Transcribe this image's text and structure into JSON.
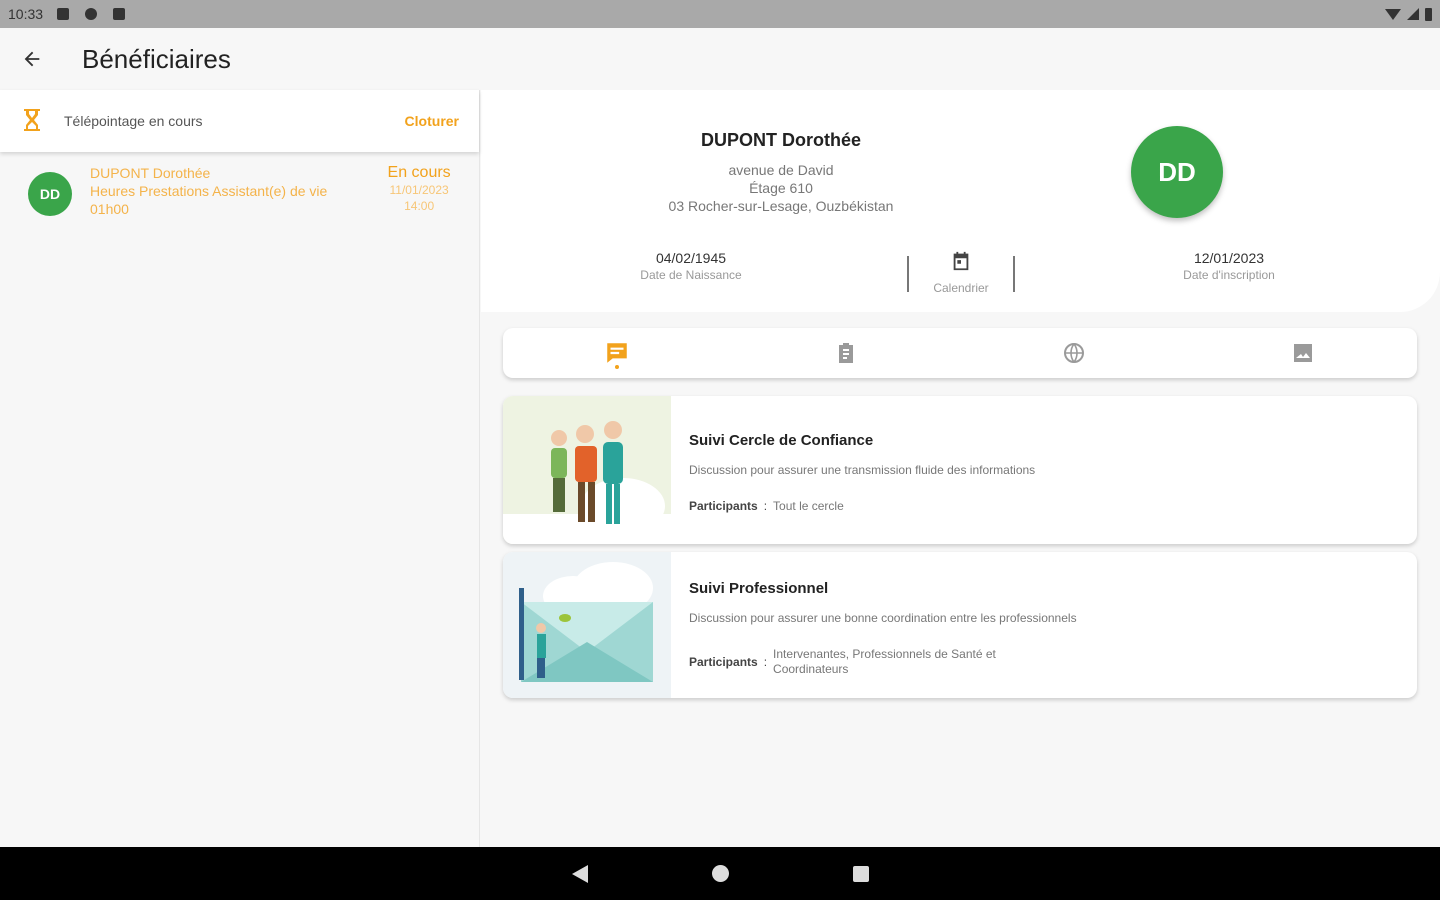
{
  "status_bar": {
    "time": "10:33"
  },
  "app_bar": {
    "title": "Bénéficiaires"
  },
  "telepointage": {
    "label": "Télépointage en cours",
    "action": "Cloturer"
  },
  "visit": {
    "avatar": "DD",
    "name": "DUPONT Dorothée",
    "service": "Heures Prestations Assistant(e) de vie",
    "duration": "01h00",
    "status": "En cours",
    "date": "11/01/2023",
    "time": "14:00"
  },
  "profile": {
    "name": "DUPONT Dorothée",
    "address_line1": "avenue de David",
    "address_line2": "Étage 610",
    "address_line3": "03 Rocher-sur-Lesage, Ouzbékistan",
    "avatar": "DD",
    "birth_date": "04/02/1945",
    "birth_label": "Date de Naissance",
    "calendar_label": "Calendrier",
    "signup_date": "12/01/2023",
    "signup_label": "Date d'inscription"
  },
  "tabs": [
    {
      "icon": "chat-icon",
      "active": true
    },
    {
      "icon": "clipboard-icon",
      "active": false
    },
    {
      "icon": "globe-icon",
      "active": false
    },
    {
      "icon": "image-icon",
      "active": false
    }
  ],
  "discussions": [
    {
      "title": "Suivi Cercle de Confiance",
      "description": "Discussion pour assurer une transmission fluide des informations",
      "participants_label": "Participants",
      "participants": "Tout le cercle"
    },
    {
      "title": "Suivi Professionnel",
      "description": "Discussion pour assurer une bonne coordination entre les professionnels",
      "participants_label": "Participants",
      "participants": "Intervenantes, Professionnels de Santé et Coordinateurs"
    }
  ],
  "colors": {
    "accent": "#f2a21c",
    "avatar": "#3aa54a"
  }
}
